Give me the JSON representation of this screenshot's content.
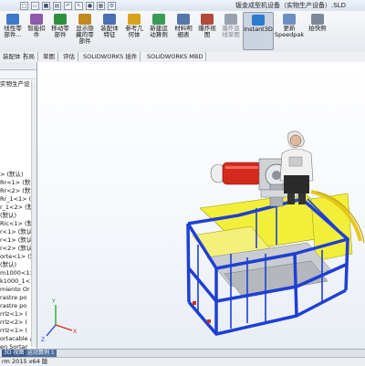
{
  "window": {
    "title": "钣金成型机设备（实物生产设备）.SLD"
  },
  "ribbon": {
    "buttons": [
      {
        "label": "线性零\n部件...",
        "icon": "linear-pattern-icon",
        "color": "#3f78c8"
      },
      {
        "label": "智能扣\n件",
        "icon": "smart-fasteners-icon",
        "color": "#8c5aa8"
      },
      {
        "label": "移动零\n部件",
        "icon": "move-component-icon",
        "color": "#2f8f3f"
      },
      {
        "label": "显示隐\n藏的零\n部件",
        "icon": "show-hidden-components-icon",
        "color": "#c08a1e"
      },
      {
        "label": "装配体\n特征",
        "icon": "assembly-features-icon",
        "color": "#4a6fb0"
      },
      {
        "label": "参考几\n何体",
        "icon": "reference-geometry-icon",
        "color": "#d8a21c"
      },
      {
        "label": "新建运\n动算例",
        "icon": "new-motion-study-icon",
        "color": "#3b9a57"
      },
      {
        "label": "材料明\n细表",
        "icon": "bill-of-materials-icon",
        "color": "#5577aa"
      },
      {
        "label": "爆炸视\n图",
        "icon": "exploded-view-icon",
        "color": "#b04a3a"
      },
      {
        "label": "爆炸直\n线草图",
        "icon": "explode-line-sketch-icon",
        "color": "#9aa3ad"
      },
      {
        "label": "Instant3D",
        "icon": "instant3d-icon",
        "color": "#2b7bd1"
      },
      {
        "label": "更新\nSpeedpak",
        "icon": "speedpak-icon",
        "color": "#6b8fc2"
      },
      {
        "label": "拍快照",
        "icon": "snapshot-icon",
        "color": "#7a8899"
      }
    ]
  },
  "command_tabs": [
    "装配体",
    "布局",
    "草图",
    "评估",
    "SOLIDWORKS 插件",
    "SOLIDWORKS MBD"
  ],
  "feature_tree": {
    "rows": [
      "实物生产设",
      "",
      "",
      "",
      "",
      "",
      "",
      "",
      "",
      "",
      "",
      "> (默认)",
      "Rr<1> (默",
      "Rr<2> (默认",
      "Rr_1<1> (默",
      "r_1<2> (默",
      "(默认)",
      "Ric<1> (默",
      "r<1> (默认",
      "r<1> (默认",
      "r<2> (默认",
      "orte<1> (默",
      "(默认)",
      "m1000<1> (",
      "k1000_1<1",
      "miento Or",
      "rastre po",
      "rastre po",
      "rrlz<1> (",
      "rrlz<2> (",
      "rrlz<1> (",
      "ortacable /",
      "en Sortar"
    ]
  },
  "bottom_tabs": [
    "3D 视图",
    "运动算例 1"
  ],
  "status_bar": {
    "text": "rm 2015 x64 版"
  },
  "colors": {
    "frame_blue": "#1f3fd4",
    "panel_yellow": "#f2ef3a",
    "motor_red": "#d42a1d",
    "machine_grey": "#9aa0a8"
  }
}
